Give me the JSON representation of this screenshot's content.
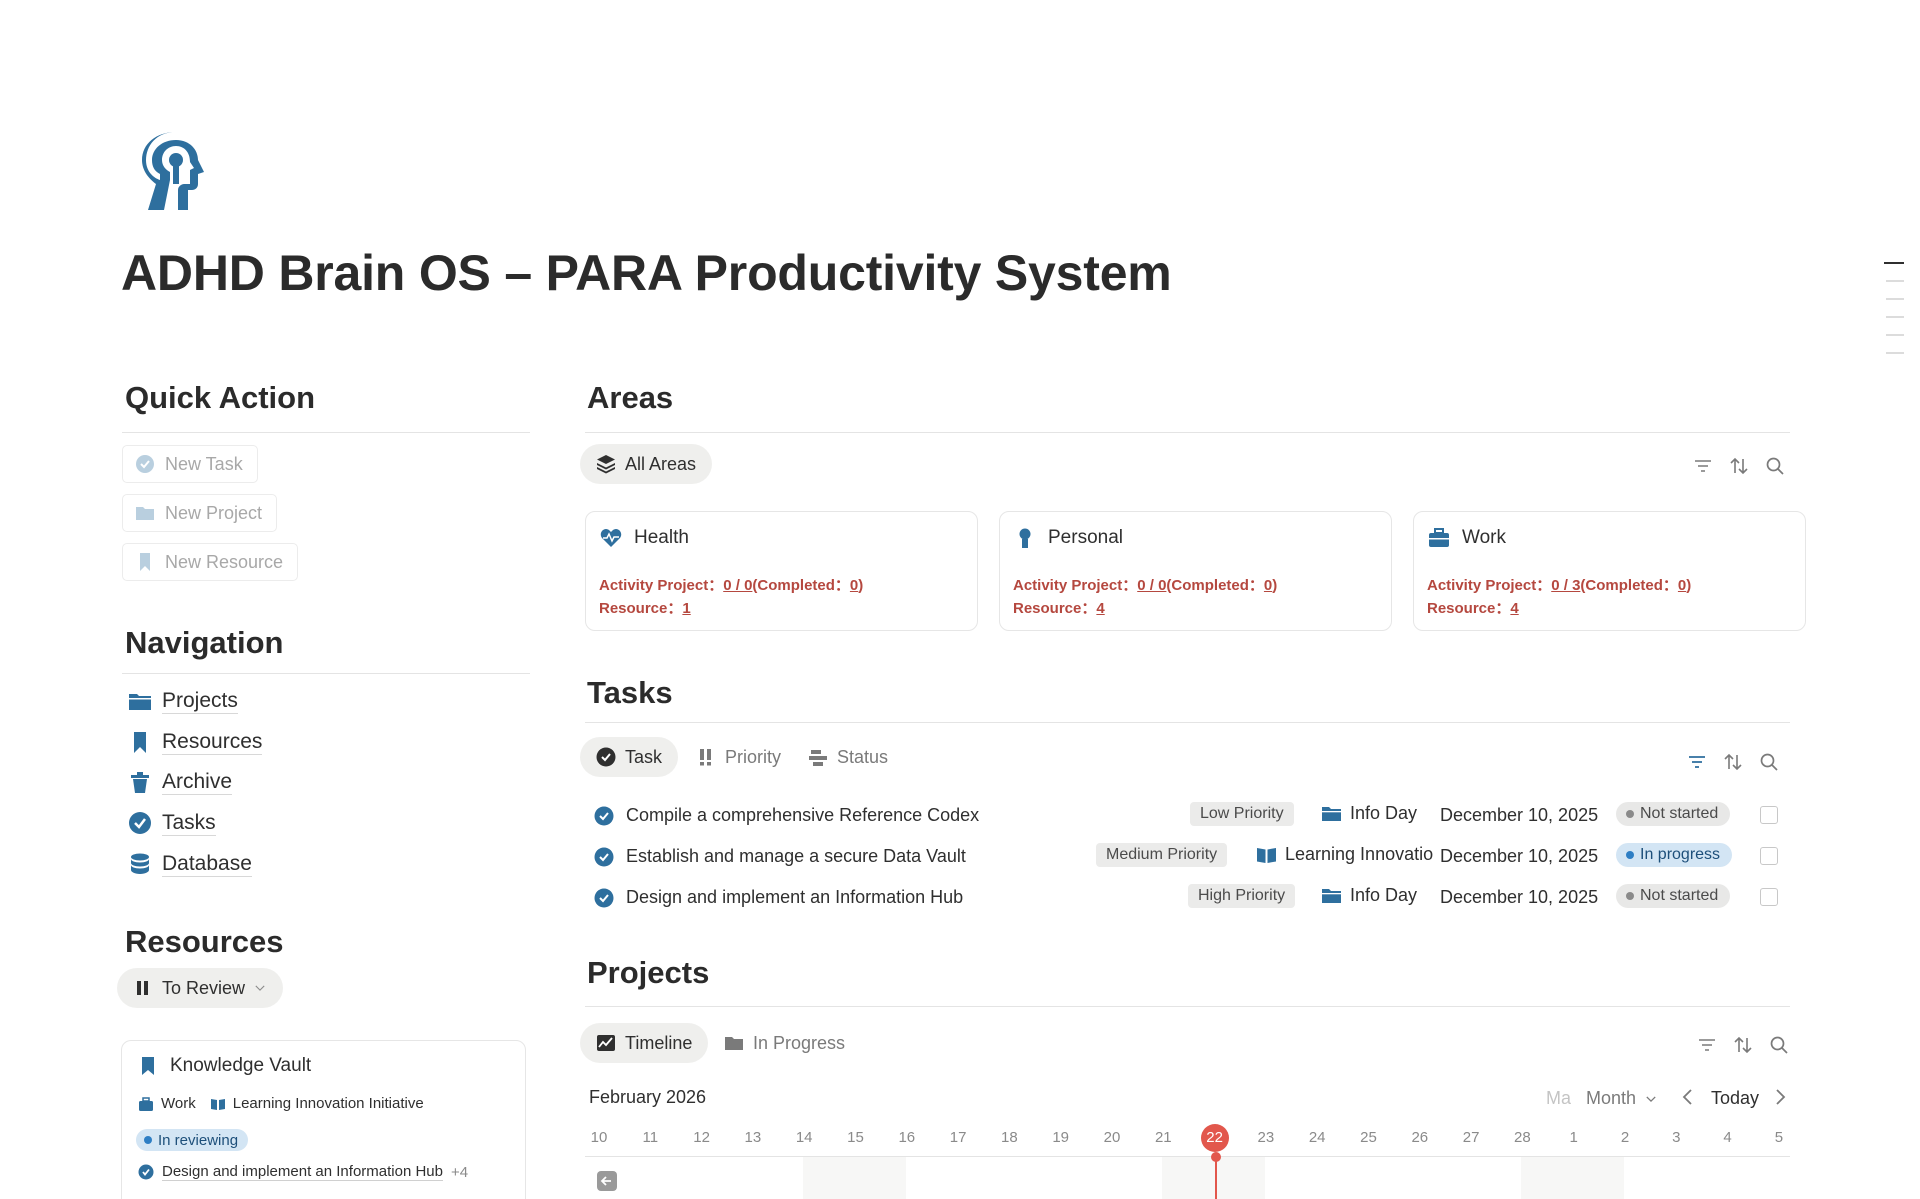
{
  "page": {
    "title": "ADHD Brain OS – PARA Productivity System",
    "icon": "head-keyhole-icon"
  },
  "quick_action": {
    "heading": "Quick Action",
    "buttons": [
      {
        "label": "New Task",
        "icon": "check-circle-icon"
      },
      {
        "label": "New Project",
        "icon": "folder-icon"
      },
      {
        "label": "New Resource",
        "icon": "bookmark-icon"
      }
    ]
  },
  "navigation": {
    "heading": "Navigation",
    "items": [
      {
        "label": "Projects",
        "icon": "folder-icon"
      },
      {
        "label": "Resources",
        "icon": "bookmark-icon"
      },
      {
        "label": "Archive",
        "icon": "trash-icon"
      },
      {
        "label": "Tasks",
        "icon": "check-circle-icon"
      },
      {
        "label": "Database",
        "icon": "database-icon"
      }
    ]
  },
  "resources": {
    "heading": "Resources",
    "view_tab": "To Review",
    "card": {
      "title": "Knowledge Vault",
      "area": "Work",
      "project": "Learning Innovation Initiative",
      "status": "In reviewing",
      "task": "Design and implement an Information Hub",
      "more": "+4"
    }
  },
  "areas": {
    "heading": "Areas",
    "view_tab": "All Areas",
    "cards": [
      {
        "name": "Health",
        "icon": "heart-pulse-icon",
        "activity_label": "Activity Project：",
        "activity_value": "0 / 0",
        "completed_label": "(Completed：",
        "completed_value": "0",
        "completed_close": ")",
        "resource_label": "Resource：",
        "resource_value": "1"
      },
      {
        "name": "Personal",
        "icon": "person-icon",
        "activity_label": "Activity Project：",
        "activity_value": "0 / 0",
        "completed_label": "(Completed：",
        "completed_value": "0",
        "completed_close": ")",
        "resource_label": "Resource：",
        "resource_value": "4"
      },
      {
        "name": "Work",
        "icon": "briefcase-icon",
        "activity_label": "Activity Project：",
        "activity_value": "0 / 3",
        "completed_label": "(Completed：",
        "completed_value": "0",
        "completed_close": ")",
        "resource_label": "Resource：",
        "resource_value": "4"
      }
    ]
  },
  "tasks": {
    "heading": "Tasks",
    "tabs": [
      {
        "label": "Task",
        "icon": "check-circle-icon",
        "active": true
      },
      {
        "label": "Priority",
        "icon": "exclamation-icon",
        "active": false
      },
      {
        "label": "Status",
        "icon": "status-bars-icon",
        "active": false
      }
    ],
    "rows": [
      {
        "name": "Compile a comprehensive Reference Codex",
        "priority": "Low Priority",
        "project": "Info Day",
        "project_icon": "folder-icon",
        "date": "December 10, 2025",
        "status": "Not started",
        "status_color": "#8a8a8a"
      },
      {
        "name": "Establish and manage a secure Data Vault",
        "priority": "Medium Priority",
        "project": "Learning Innovation Initiative",
        "project_icon": "book-open-icon",
        "date": "December 10, 2025",
        "status": "In progress",
        "status_color": "#2e7ec4"
      },
      {
        "name": "Design and implement an Information Hub",
        "priority": "High Priority",
        "project": "Info Day",
        "project_icon": "folder-icon",
        "date": "December 10, 2025",
        "status": "Not started",
        "status_color": "#8a8a8a"
      }
    ]
  },
  "projects": {
    "heading": "Projects",
    "tabs": [
      {
        "label": "Timeline",
        "icon": "chart-line-icon",
        "active": true
      },
      {
        "label": "In Progress",
        "icon": "folder-icon",
        "active": false
      }
    ],
    "timeline": {
      "month_label": "February 2026",
      "manage_label": "Ma",
      "scale_label": "Month",
      "today_label": "Today",
      "today_day": "22",
      "days": [
        "10",
        "11",
        "12",
        "13",
        "14",
        "15",
        "16",
        "17",
        "18",
        "19",
        "20",
        "21",
        "22",
        "23",
        "24",
        "25",
        "26",
        "27",
        "28",
        "1",
        "2",
        "3",
        "4",
        "5"
      ]
    }
  },
  "colors": {
    "accent_blue": "#2e6f9e",
    "area_red": "#b5483f",
    "today_red": "#e2574c",
    "in_progress_bg": "#d3e5f4"
  }
}
